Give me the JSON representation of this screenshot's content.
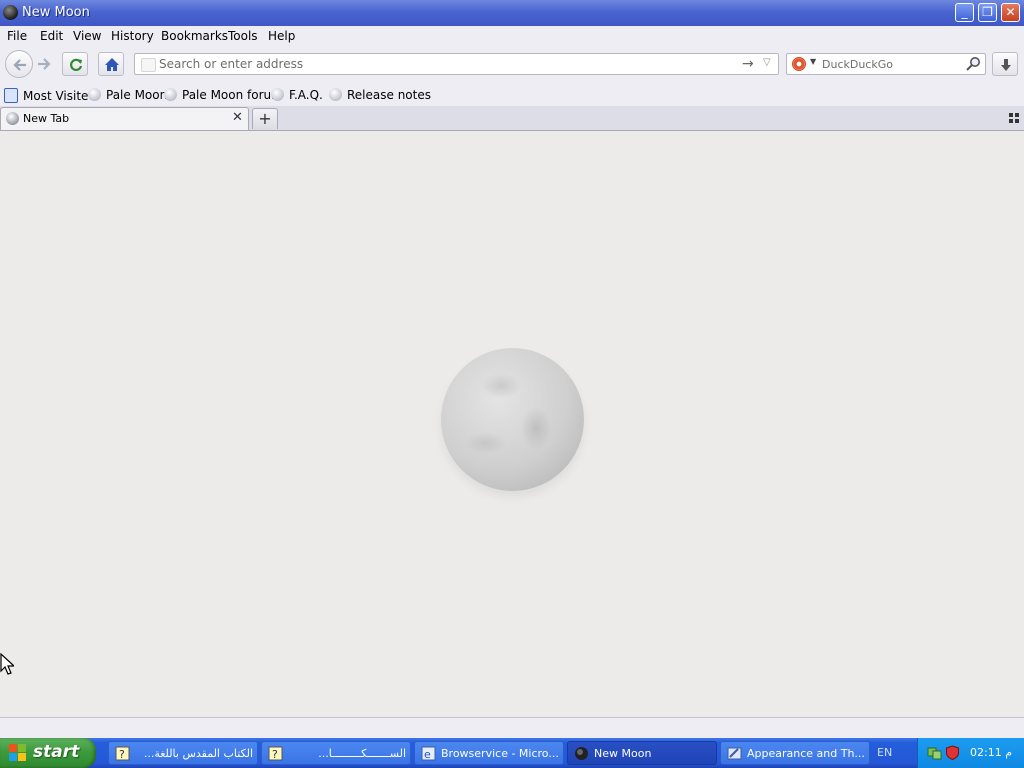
{
  "window": {
    "title": "New Moon"
  },
  "menu": [
    "File",
    "Edit",
    "View",
    "History",
    "Bookmarks",
    "Tools",
    "Help"
  ],
  "urlbar": {
    "placeholder": "Search or enter address"
  },
  "search": {
    "engine_placeholder": "DuckDuckGo"
  },
  "bookmarks": [
    "Most Visited",
    "Pale Moon",
    "Pale Moon forum",
    "F.A.Q.",
    "Release notes"
  ],
  "tabs": [
    {
      "label": "New Tab"
    }
  ],
  "taskbar": {
    "start_label": "start",
    "tasks": [
      {
        "label": "الكتاب المقدس باللغة...",
        "icon": "help-doc-icon",
        "rtl": true
      },
      {
        "label": "الســـــــكـــــــــا...",
        "icon": "help-doc-icon",
        "rtl": true
      },
      {
        "label": "Browservice - Micro...",
        "icon": "ie-icon",
        "rtl": false
      },
      {
        "label": "New Moon",
        "icon": "newmoon-icon",
        "rtl": false,
        "active": true
      },
      {
        "label": "Appearance and Th...",
        "icon": "control-panel-icon",
        "rtl": false
      }
    ],
    "language": "EN",
    "clock": "02:11 م"
  }
}
